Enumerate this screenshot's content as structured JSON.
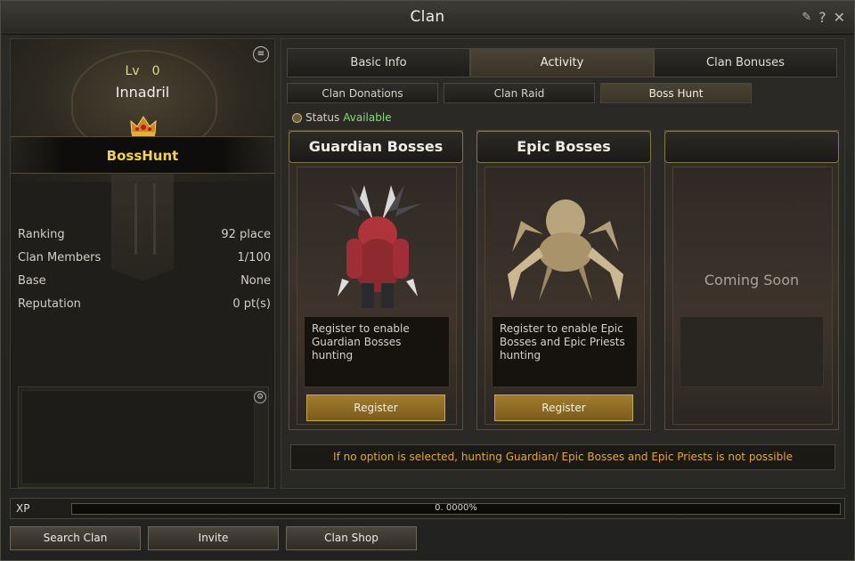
{
  "window": {
    "title": "Clan"
  },
  "titlebar_icons": {
    "pin": "pin-icon",
    "help": "?",
    "close": "✕"
  },
  "clan": {
    "level_label": "Lv",
    "level_value": "0",
    "server_name": "Innadril",
    "clan_name": "BossHunt",
    "crest_icon": "crown-icon"
  },
  "stats": [
    {
      "label": "Ranking",
      "value": "92 place"
    },
    {
      "label": "Clan Members",
      "value": "1/100"
    },
    {
      "label": "Base",
      "value": "None"
    },
    {
      "label": "Reputation",
      "value": "0 pt(s)"
    }
  ],
  "tabs": [
    {
      "label": "Basic Info",
      "active": false
    },
    {
      "label": "Activity",
      "active": true
    },
    {
      "label": "Clan Bonuses",
      "active": false
    }
  ],
  "subtabs": [
    {
      "label": "Clan Donations",
      "active": false
    },
    {
      "label": "Clan Raid",
      "active": false
    },
    {
      "label": "Boss Hunt",
      "active": true
    }
  ],
  "status": {
    "label": "Status",
    "value": "Available"
  },
  "cards": [
    {
      "title": "Guardian Bosses",
      "description": "Register to enable Guardian Bosses hunting",
      "button": "Register"
    },
    {
      "title": "Epic Bosses",
      "description": "Register to enable Epic Bosses and Epic Priests hunting",
      "button": "Register"
    },
    {
      "title": "",
      "coming_soon": "Coming Soon"
    }
  ],
  "warning": "If no option is selected, hunting Guardian/ Epic Bosses and Epic Priests is not possible",
  "xp": {
    "label": "XP",
    "value_text": "0. 0000%",
    "progress": 0.0
  },
  "bottom_buttons": [
    "Search Clan",
    "Invite",
    "Clan Shop"
  ]
}
